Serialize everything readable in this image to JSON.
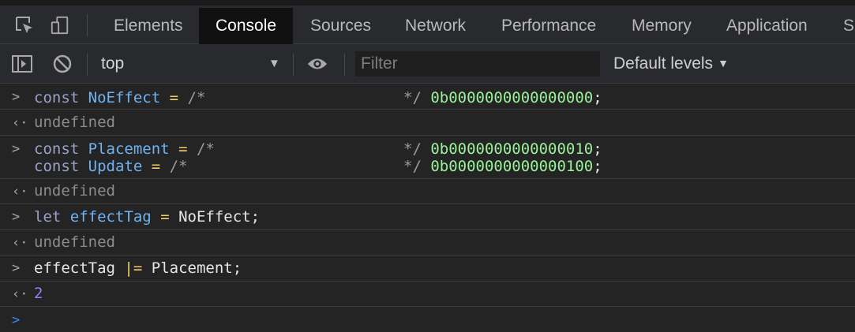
{
  "tabs": [
    "Elements",
    "Console",
    "Sources",
    "Network",
    "Performance",
    "Memory",
    "Application",
    "S"
  ],
  "toolbar": {
    "context": "top",
    "filter_placeholder": "Filter",
    "levels": "Default levels"
  },
  "console": {
    "entries": [
      {
        "kw": "const",
        "name": "NoEffect",
        "op": "=",
        "open_comment": "/*",
        "close_comment": "*/",
        "value": "0b0000000000000000",
        "semi": ";"
      },
      {
        "result": "undefined"
      },
      {
        "kw": "const",
        "name": "Placement",
        "op": "=",
        "open_comment": "/*",
        "close_comment": "*/",
        "value": "0b0000000000000010",
        "semi": ";"
      },
      {
        "kw": "const",
        "name": "Update",
        "op": "=",
        "open_comment": "/*",
        "close_comment": "*/",
        "value": "0b0000000000000100",
        "semi": ";"
      },
      {
        "result": "undefined"
      },
      {
        "kw": "let",
        "name": "effectTag",
        "op": "=",
        "rhs": "NoEffect;"
      },
      {
        "result": "undefined"
      },
      {
        "lhs": "effectTag",
        "op": "|=",
        "rhs": "Placement;"
      },
      {
        "result": "2"
      }
    ]
  },
  "icons": {
    "inspect": "element-picker-icon",
    "device": "device-toolbar-icon",
    "sidebar": "sidebar-toggle-icon",
    "clear": "clear-console-icon",
    "eye": "live-expression-icon"
  }
}
